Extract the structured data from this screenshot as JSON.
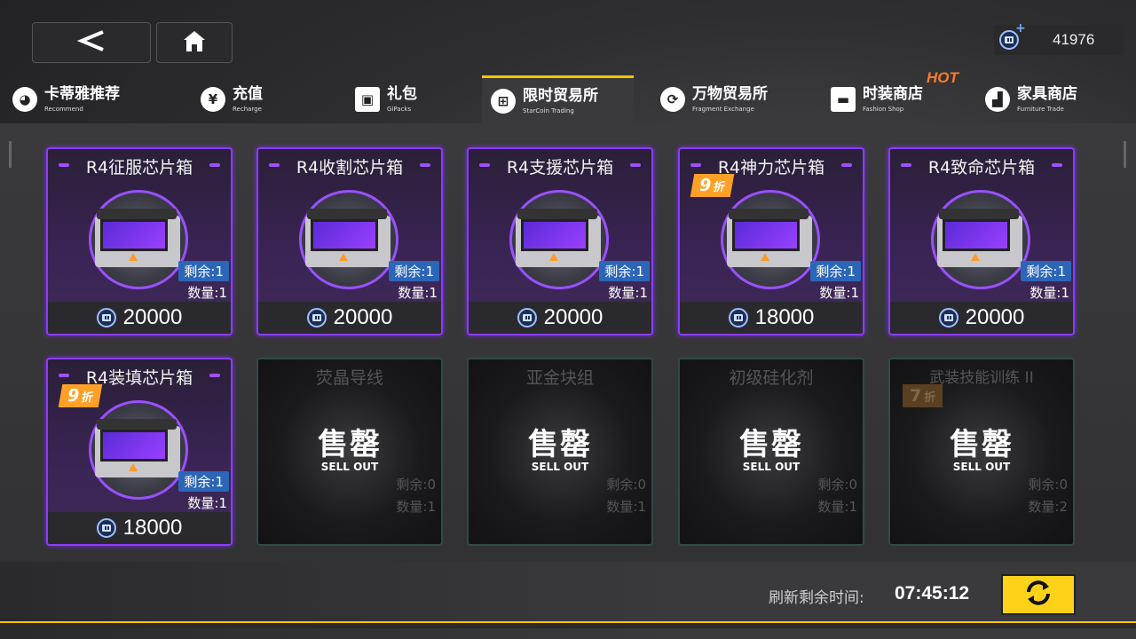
{
  "header": {
    "currency_amount": "41976"
  },
  "tabs": [
    {
      "zh": "卡蒂雅推荐",
      "en": "Recommend",
      "icon": "bunny-icon"
    },
    {
      "zh": "充值",
      "en": "Recharge",
      "icon": "yen-icon"
    },
    {
      "zh": "礼包",
      "en": "GiPacks",
      "icon": "gift-icon"
    },
    {
      "zh": "限时贸易所",
      "en": "StarCoin Trading",
      "icon": "grid-icon"
    },
    {
      "zh": "万物贸易所",
      "en": "Fragment Exchange",
      "icon": "exchange-icon"
    },
    {
      "zh": "时装商店",
      "en": "Fashion Shop",
      "icon": "shop-icon"
    },
    {
      "zh": "家具商店",
      "en": "Furniture Trade",
      "icon": "sofa-icon"
    }
  ],
  "hot_badge": "HOT",
  "items": [
    {
      "name": "R4征服芯片箱",
      "remain": "剩余:1",
      "qty": "数量:1",
      "price": "20000",
      "discount": ""
    },
    {
      "name": "R4收割芯片箱",
      "remain": "剩余:1",
      "qty": "数量:1",
      "price": "20000",
      "discount": ""
    },
    {
      "name": "R4支援芯片箱",
      "remain": "剩余:1",
      "qty": "数量:1",
      "price": "20000",
      "discount": ""
    },
    {
      "name": "R4神力芯片箱",
      "remain": "剩余:1",
      "qty": "数量:1",
      "price": "18000",
      "discount": "9"
    },
    {
      "name": "R4致命芯片箱",
      "remain": "剩余:1",
      "qty": "数量:1",
      "price": "20000",
      "discount": ""
    },
    {
      "name": "R4装填芯片箱",
      "remain": "剩余:1",
      "qty": "数量:1",
      "price": "18000",
      "discount": "9"
    },
    {
      "name": "荧晶导线",
      "remain": "剩余:0",
      "qty": "数量:1",
      "sold": true
    },
    {
      "name": "亚金块组",
      "remain": "剩余:0",
      "qty": "数量:1",
      "sold": true
    },
    {
      "name": "初级硅化剂",
      "remain": "剩余:0",
      "qty": "数量:1",
      "sold": true
    },
    {
      "name": "武装技能训练 II",
      "remain": "剩余:0",
      "qty": "数量:2",
      "sold": true,
      "discount": "7"
    }
  ],
  "discount_suffix": "折",
  "soldout": {
    "zh": "售罄",
    "en": "SELL OUT"
  },
  "footer": {
    "refresh_label": "刷新剩余时间:",
    "refresh_time": "07:45:12"
  },
  "colors": {
    "accent": "#ffc400",
    "card_border": "#8a3cff",
    "discount": "#ffa126",
    "remain_badge": "#2c66b8"
  }
}
